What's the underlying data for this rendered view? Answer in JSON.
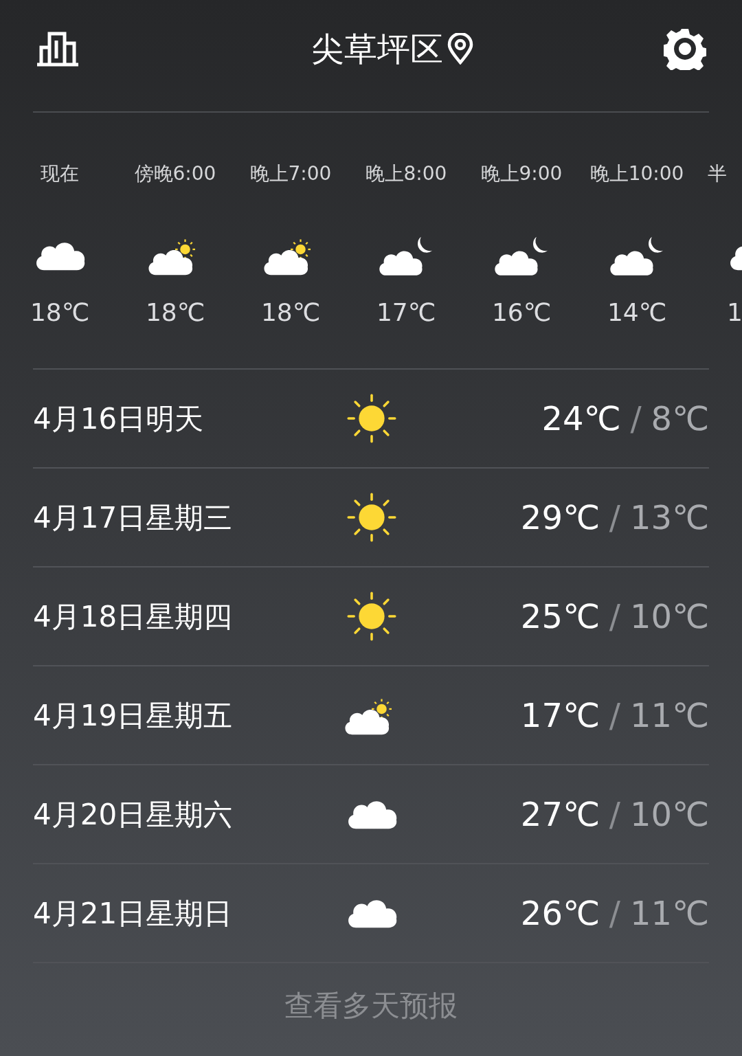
{
  "header": {
    "location": "尖草坪区"
  },
  "hourly": [
    {
      "time": "现在",
      "kind": "cloud",
      "temp": "18℃"
    },
    {
      "time": "傍晚6:00",
      "kind": "sun-cloud",
      "temp": "18℃"
    },
    {
      "time": "晚上7:00",
      "kind": "sun-cloud",
      "temp": "18℃"
    },
    {
      "time": "晚上8:00",
      "kind": "moon-cloud",
      "temp": "17℃"
    },
    {
      "time": "晚上9:00",
      "kind": "moon-cloud",
      "temp": "16℃"
    },
    {
      "time": "晚上10:00",
      "kind": "moon-cloud",
      "temp": "14℃"
    },
    {
      "time": "半",
      "kind": "cloud",
      "temp": "1"
    }
  ],
  "daily": [
    {
      "date": "4月16日明天",
      "kind": "sun",
      "high": "24℃",
      "separator": "/",
      "low": "8℃"
    },
    {
      "date": "4月17日星期三",
      "kind": "sun",
      "high": "29℃",
      "separator": "/",
      "low": "13℃"
    },
    {
      "date": "4月18日星期四",
      "kind": "sun",
      "high": "25℃",
      "separator": "/",
      "low": "10℃"
    },
    {
      "date": "4月19日星期五",
      "kind": "sun-cloud",
      "high": "17℃",
      "separator": "/",
      "low": "11℃"
    },
    {
      "date": "4月20日星期六",
      "kind": "cloud",
      "high": "27℃",
      "separator": "/",
      "low": "10℃"
    },
    {
      "date": "4月21日星期日",
      "kind": "cloud",
      "high": "26℃",
      "separator": "/",
      "low": "11℃"
    }
  ],
  "footer": {
    "link": "查看多天预报"
  }
}
